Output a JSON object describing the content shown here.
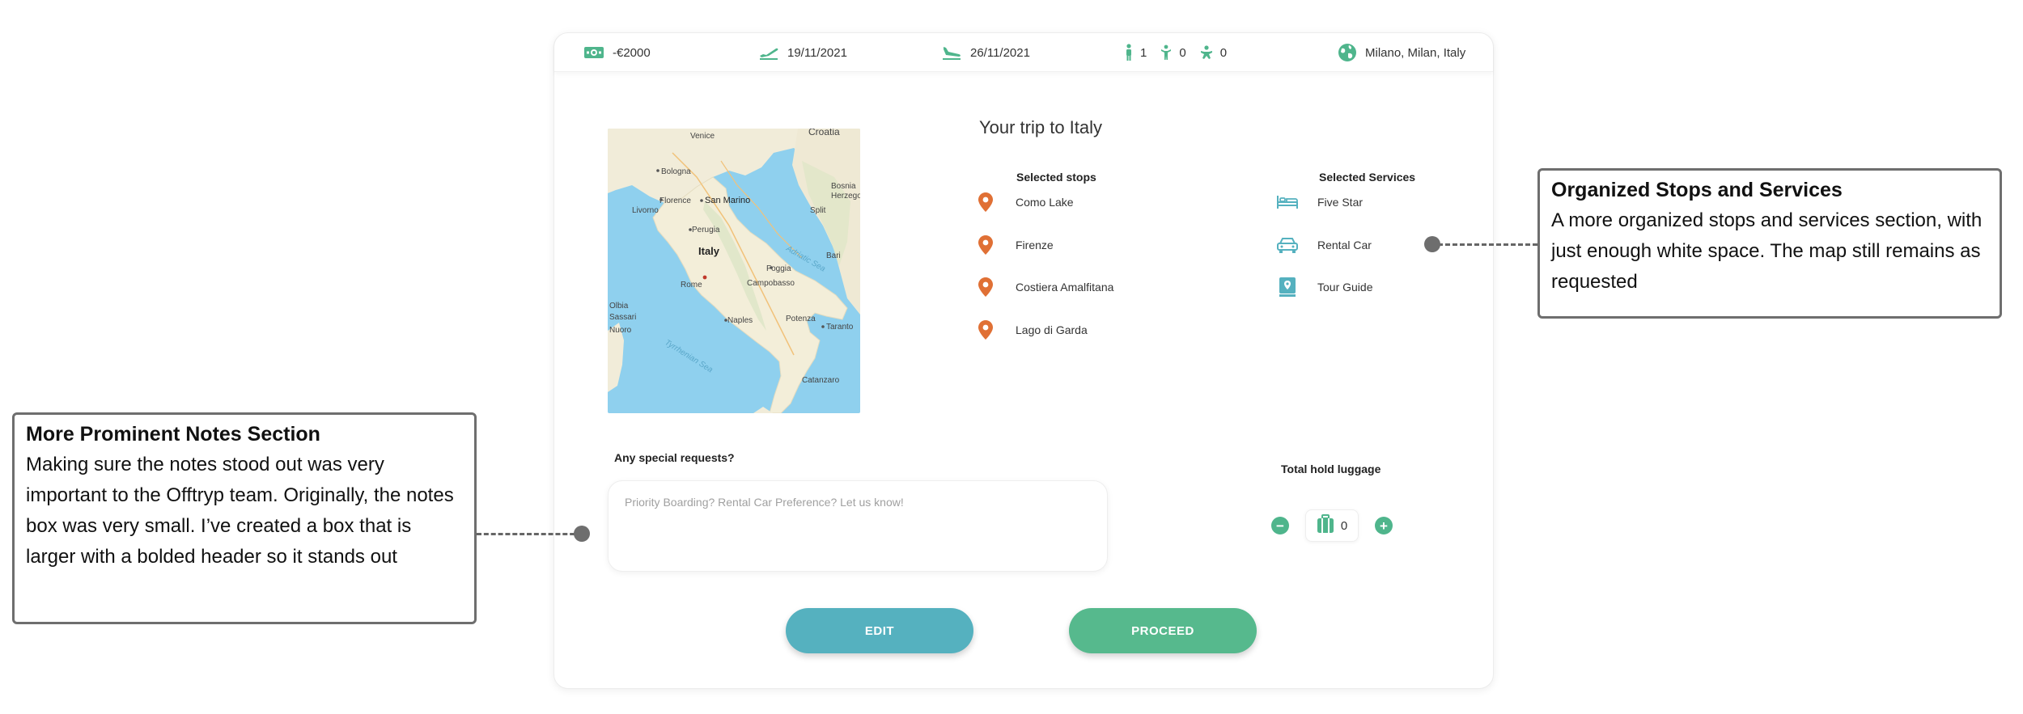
{
  "topbar": {
    "budget": "-€2000",
    "depart_date": "19/11/2021",
    "return_date": "26/11/2021",
    "adults": "1",
    "children": "0",
    "infants": "0",
    "location": "Milano, Milan, Italy"
  },
  "map": {
    "country": "Italy",
    "labels": {
      "croatia": "Croatia",
      "venice": "Venice",
      "bologna": "Bologna",
      "san_marino": "San Marino",
      "livorno": "Livorno",
      "florence": "Florence",
      "perugia": "Perugia",
      "adriatic": "Adriatic Sea",
      "bosnia": "Bosnia",
      "herzego": "Herzego",
      "split": "Split",
      "rome": "Rome",
      "campobasso": "Campobasso",
      "foggia": "Foggia",
      "bari": "Bari",
      "naples": "Naples",
      "potenza": "Potenza",
      "taranto": "Taranto",
      "nuoro": "Nuoro",
      "tyrrhenian": "Tyrrhenian Sea",
      "catanzaro": "Catanzaro",
      "olbia": "Olbia",
      "sassari": "Sassari"
    }
  },
  "trip": {
    "title": "Your trip to Italy",
    "stops_title": "Selected stops",
    "stops": [
      "Como Lake",
      "Firenze",
      "Costiera Amalfitana",
      "Lago di Garda"
    ],
    "services_title": "Selected Services",
    "services": [
      "Five Star",
      "Rental Car",
      "Tour Guide"
    ]
  },
  "requests": {
    "label": "Any special requests?",
    "placeholder": "Priority Boarding? Rental Car Preference? Let us know!"
  },
  "luggage": {
    "label": "Total hold luggage",
    "count": "0",
    "minus": "−",
    "plus": "+"
  },
  "buttons": {
    "edit": "EDIT",
    "proceed": "PROCEED"
  },
  "annotations": {
    "right": {
      "title": "Organized Stops and Services",
      "body": "A more organized stops and services section, with just enough white space. The map still remains as requested"
    },
    "left": {
      "title": "More Prominent Notes Section",
      "body": "Making sure the notes stood out was very important to the Offtryp team. Originally, the notes box was very small. I’ve created a box that is larger with a bolded header so it stands out"
    }
  },
  "colors": {
    "green": "#4fb58c",
    "teal": "#55b1bf",
    "orange": "#e07035",
    "sea": "#8fd0ee",
    "land": "#f1ecd9"
  }
}
